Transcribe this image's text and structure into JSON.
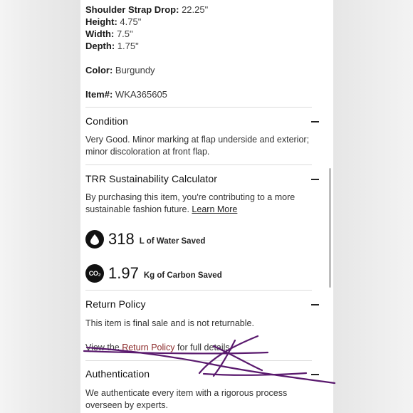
{
  "specs": {
    "strap_drop": {
      "label": "Shoulder Strap Drop:",
      "value": "22.25\""
    },
    "height": {
      "label": "Height:",
      "value": "4.75\""
    },
    "width": {
      "label": "Width:",
      "value": "7.5\""
    },
    "depth": {
      "label": "Depth:",
      "value": "1.75\""
    },
    "color": {
      "label": "Color:",
      "value": "Burgundy"
    },
    "item": {
      "label": "Item#:",
      "value": "WKA365605"
    }
  },
  "condition": {
    "title": "Condition",
    "text": "Very Good. Minor marking at flap underside and exterior; minor discoloration at front flap."
  },
  "sustainability": {
    "title": "TRR Sustainability Calculator",
    "text": "By purchasing this item, you're contributing to a more sustainable fashion future.",
    "link": "Learn More",
    "water": {
      "value": "318",
      "unit": "L of Water Saved",
      "icon": "water-drop-icon"
    },
    "carbon": {
      "value": "1.97",
      "unit": "Kg of Carbon Saved",
      "icon": "co2-icon",
      "icon_text": "CO₂"
    }
  },
  "return_policy": {
    "title": "Return Policy",
    "text": "This item is final sale and is not returnable.",
    "link_prefix": "View the",
    "link": "Return Policy",
    "link_suffix": "for full details."
  },
  "authentication": {
    "title": "Authentication",
    "text": "We authenticate every item with a rigorous process overseen by experts."
  },
  "colors": {
    "link_red": "#8b2a2a",
    "scribble": "#5a1a6e",
    "text": "#1a1a1a"
  }
}
